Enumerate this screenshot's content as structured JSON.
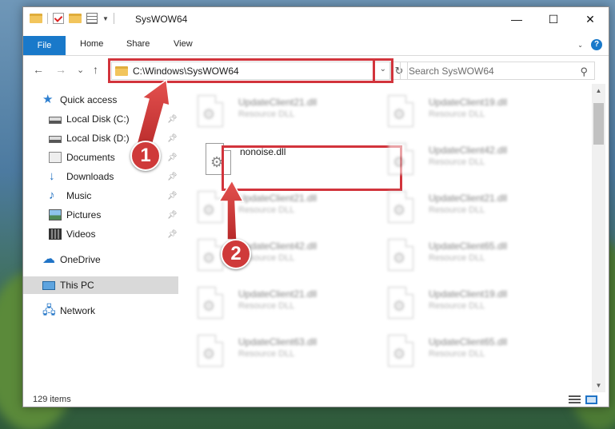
{
  "window": {
    "title": "SysWOW64",
    "controls": {
      "minimize": "—",
      "maximize": "☐",
      "close": "✕"
    }
  },
  "ribbon": {
    "tabs": [
      "File",
      "Home",
      "Share",
      "View"
    ],
    "help_icon": "?"
  },
  "navigation": {
    "back_icon": "←",
    "forward_icon": "→",
    "recent_icon": "⌄",
    "up_icon": "↑",
    "address": "C:\\Windows\\SysWOW64",
    "address_dropdown": "⌄",
    "refresh_icon": "↻",
    "search_placeholder": "Search SysWOW64",
    "search_icon": "⚲"
  },
  "sidebar": {
    "items": [
      {
        "label": "Quick access",
        "icon": "star-icon",
        "pinned": false
      },
      {
        "label": "Local Disk (C:)",
        "icon": "drive-icon",
        "pinned": true
      },
      {
        "label": "Local Disk (D:)",
        "icon": "drive-icon",
        "pinned": true
      },
      {
        "label": "Documents",
        "icon": "documents-icon",
        "pinned": true
      },
      {
        "label": "Downloads",
        "icon": "download-icon",
        "pinned": true
      },
      {
        "label": "Music",
        "icon": "music-icon",
        "pinned": true
      },
      {
        "label": "Pictures",
        "icon": "pictures-icon",
        "pinned": true
      },
      {
        "label": "Videos",
        "icon": "videos-icon",
        "pinned": true
      },
      {
        "label": "OneDrive",
        "icon": "cloud-icon",
        "pinned": false
      },
      {
        "label": "This PC",
        "icon": "pc-icon",
        "pinned": false,
        "selected": true
      },
      {
        "label": "Network",
        "icon": "network-icon",
        "pinned": false
      }
    ]
  },
  "files": [
    {
      "name": "UpdateClient21.dll",
      "type": "Resource DLL",
      "blurred": true
    },
    {
      "name": "UpdateClient19.dll",
      "type": "Resource DLL",
      "blurred": true
    },
    {
      "name": "nonoise.dll",
      "type": "",
      "blurred": false,
      "highlighted": true
    },
    {
      "name": "UpdateClient42.dll",
      "type": "Resource DLL",
      "blurred": true
    },
    {
      "name": "UpdateClient21.dll",
      "type": "Resource DLL",
      "blurred": true
    },
    {
      "name": "UpdateClient21.dll",
      "type": "Resource DLL",
      "blurred": true
    },
    {
      "name": "UpdateClient42.dll",
      "type": "Resource DLL",
      "blurred": true
    },
    {
      "name": "UpdateClient65.dll",
      "type": "Resource DLL",
      "blurred": true
    },
    {
      "name": "UpdateClient21.dll",
      "type": "Resource DLL",
      "blurred": true
    },
    {
      "name": "UpdateClient19.dll",
      "type": "Resource DLL",
      "blurred": true
    },
    {
      "name": "UpdateClient63.dll",
      "type": "Resource DLL",
      "blurred": true
    },
    {
      "name": "UpdateClient65.dll",
      "type": "Resource DLL",
      "blurred": true
    }
  ],
  "status": {
    "item_count": "129 items"
  },
  "callouts": [
    "1",
    "2"
  ],
  "colors": {
    "accent": "#1979ca",
    "highlight": "#d2343c",
    "badge": "#cf3a3a"
  }
}
